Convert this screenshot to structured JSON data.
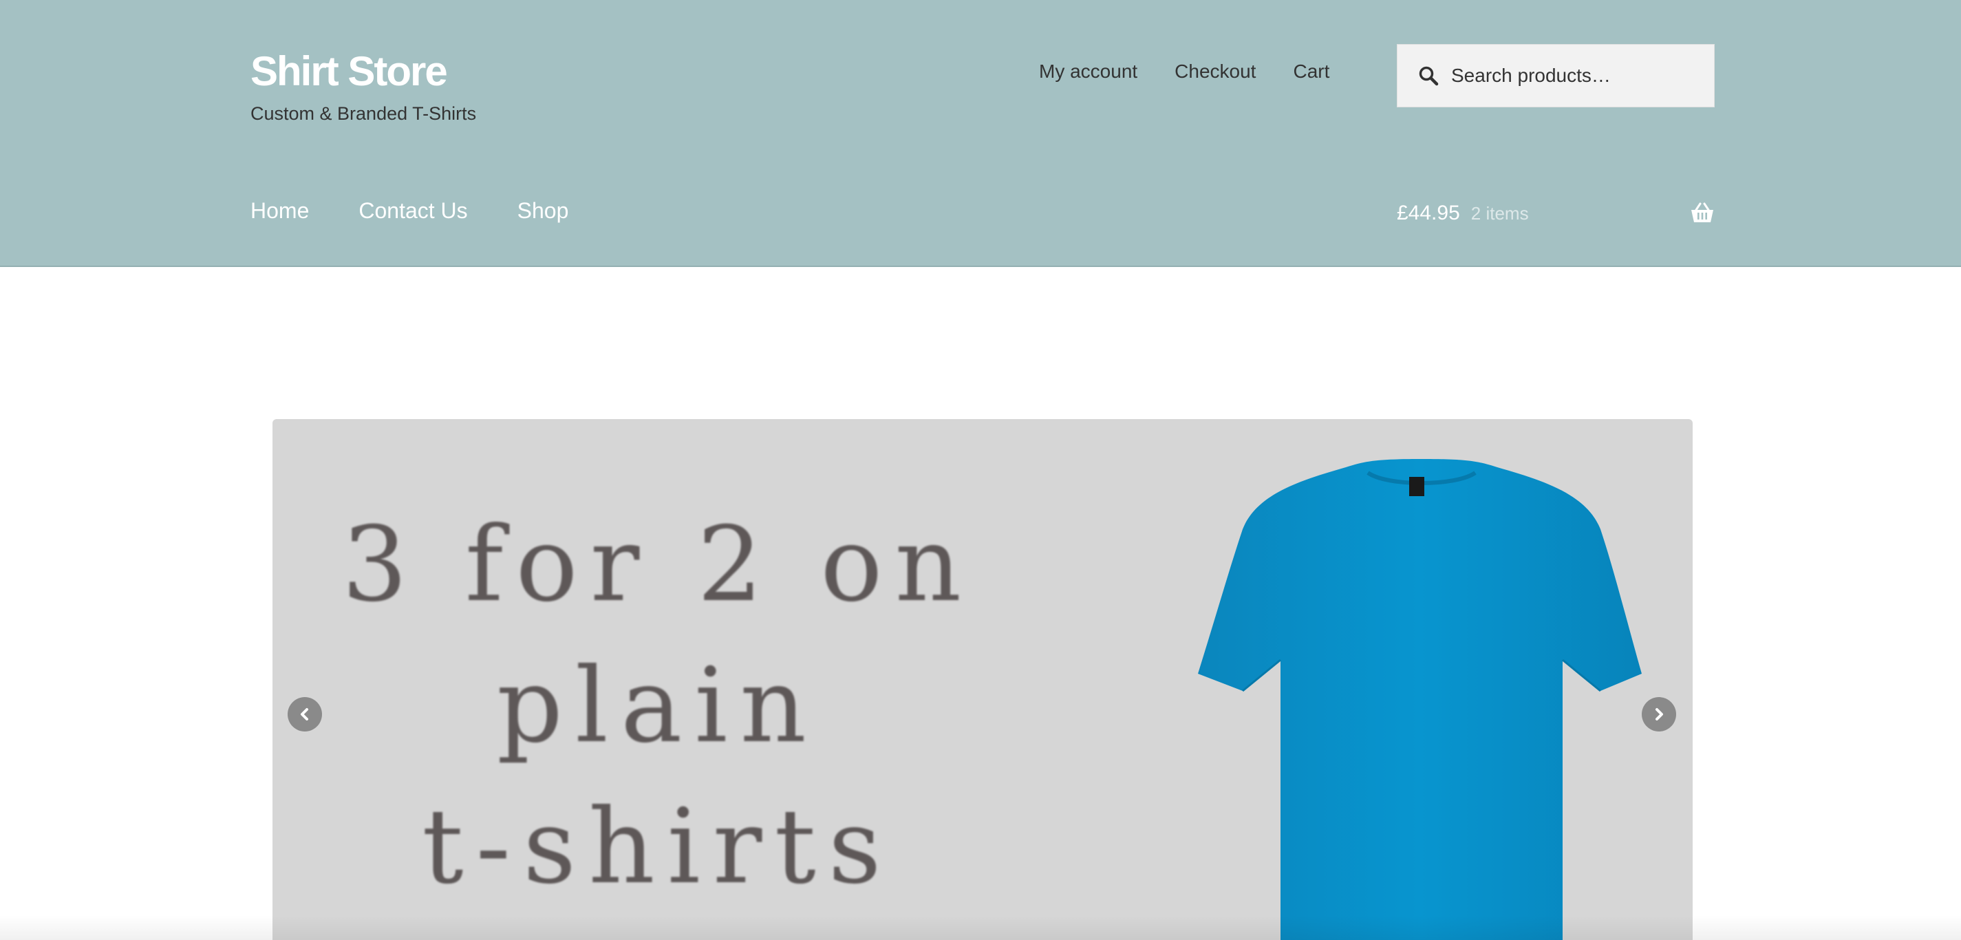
{
  "site": {
    "title": "Shirt Store",
    "tagline": "Custom & Branded T-Shirts"
  },
  "secondary_nav": {
    "items": [
      {
        "label": "My account"
      },
      {
        "label": "Checkout"
      },
      {
        "label": "Cart"
      }
    ]
  },
  "search": {
    "placeholder": "Search products…",
    "icon": "search-icon"
  },
  "primary_nav": {
    "items": [
      {
        "label": "Home"
      },
      {
        "label": "Contact Us"
      },
      {
        "label": "Shop"
      }
    ]
  },
  "cart": {
    "amount": "£44.95",
    "count_label": "2 items",
    "icon": "basket-icon"
  },
  "hero": {
    "lines": [
      "3 for 2 on",
      "plain",
      "t-shirts"
    ],
    "prev_icon": "chevron-left-icon",
    "next_icon": "chevron-right-icon"
  },
  "colors": {
    "header_bg": "#a4c1c3",
    "slider_bg": "#d6d6d6",
    "tshirt": "#0590c8"
  }
}
